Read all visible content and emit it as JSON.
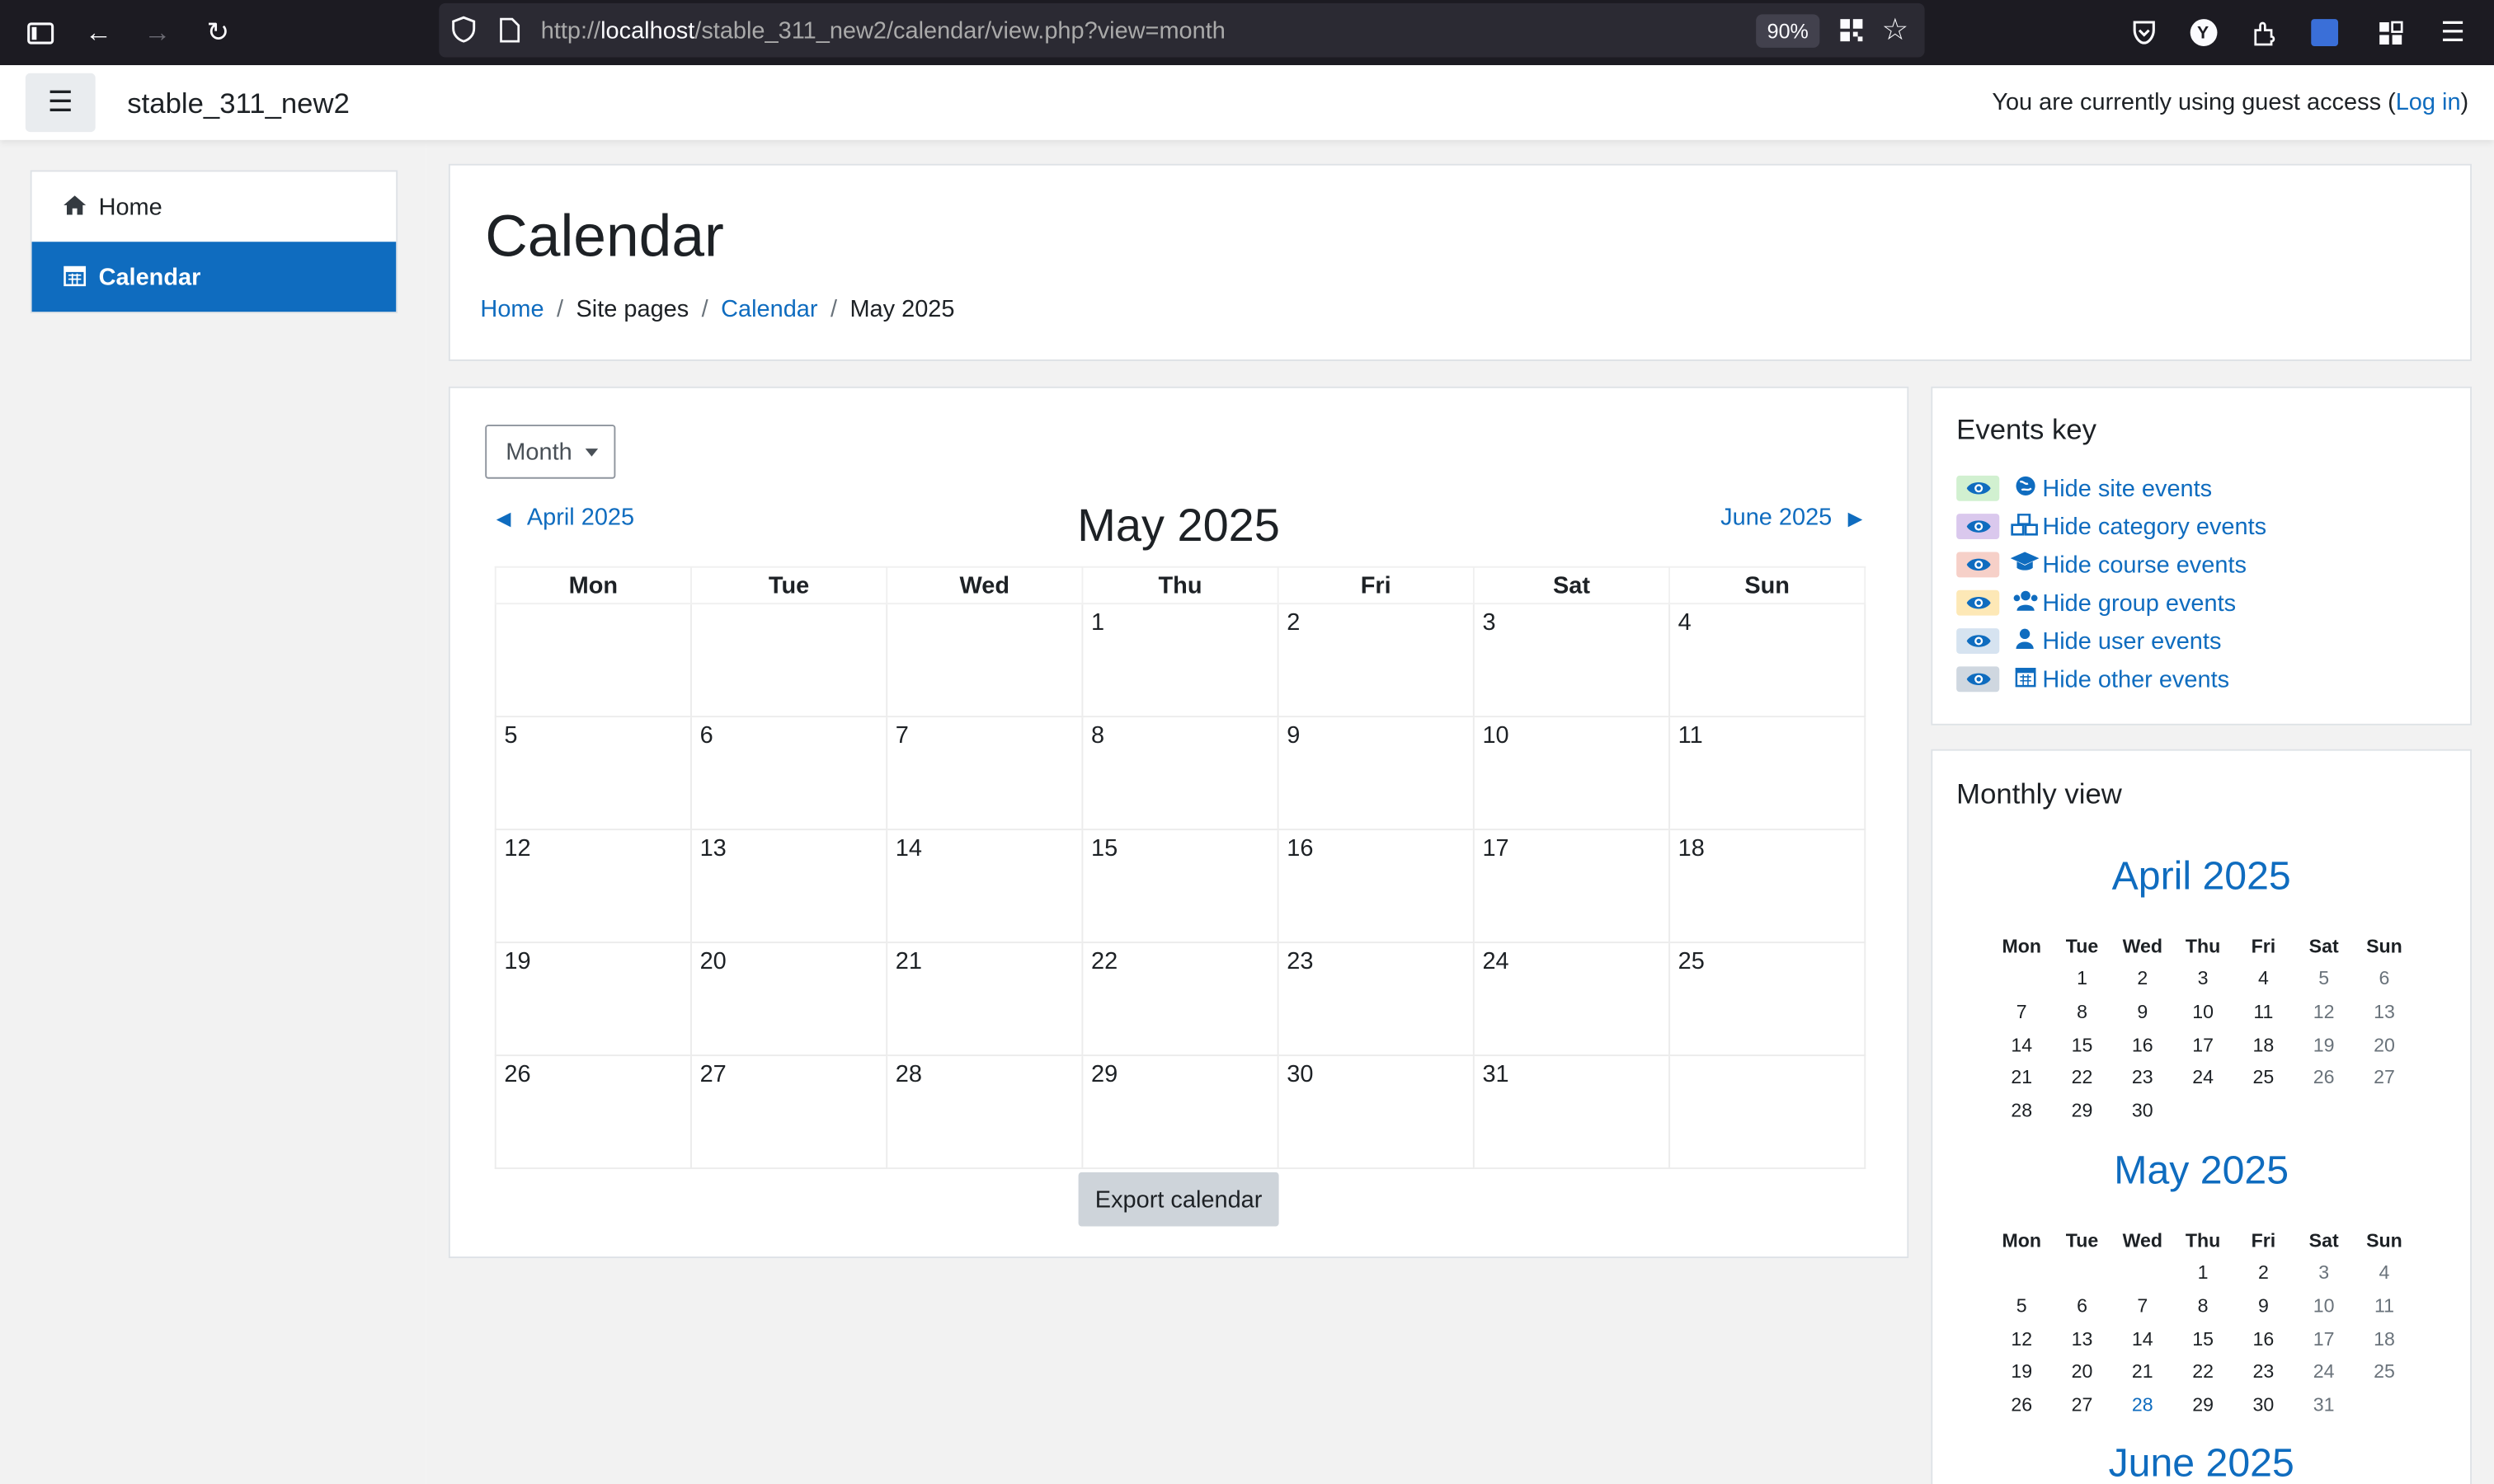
{
  "browser": {
    "url_prefix": "http://",
    "url_host": "localhost",
    "url_path": "/stable_311_new2/calendar/view.php?view=month",
    "zoom": "90%"
  },
  "navbar": {
    "site_name": "stable_311_new2",
    "guest_text": "You are currently using guest access (",
    "login_label": "Log in",
    "guest_close": ")"
  },
  "drawer": {
    "items": [
      {
        "label": "Home",
        "icon": "home-icon",
        "active": false
      },
      {
        "label": "Calendar",
        "icon": "calendar-icon",
        "active": true
      }
    ]
  },
  "header": {
    "title": "Calendar",
    "breadcrumb": [
      "Home",
      "Site pages",
      "Calendar",
      "May 2025"
    ]
  },
  "calendar": {
    "view_select": "Month",
    "prev_label": "April 2025",
    "next_label": "June 2025",
    "month_title": "May 2025",
    "weekdays": [
      "Mon",
      "Tue",
      "Wed",
      "Thu",
      "Fri",
      "Sat",
      "Sun"
    ],
    "weeks": [
      [
        "",
        "",
        "",
        "1",
        "2",
        "3",
        "4"
      ],
      [
        "5",
        "6",
        "7",
        "8",
        "9",
        "10",
        "11"
      ],
      [
        "12",
        "13",
        "14",
        "15",
        "16",
        "17",
        "18"
      ],
      [
        "19",
        "20",
        "21",
        "22",
        "23",
        "24",
        "25"
      ],
      [
        "26",
        "27",
        "28",
        "29",
        "30",
        "31",
        ""
      ]
    ],
    "export_label": "Export calendar"
  },
  "events_key": {
    "title": "Events key",
    "items": [
      {
        "label": "Hide site events",
        "icon": "globe-icon",
        "color": "#d1f0d0"
      },
      {
        "label": "Hide category events",
        "icon": "cubes-icon",
        "color": "#dac8ed"
      },
      {
        "label": "Hide course events",
        "icon": "graduation-cap-icon",
        "color": "#f6d0c8"
      },
      {
        "label": "Hide group events",
        "icon": "users-icon",
        "color": "#fde8b6"
      },
      {
        "label": "Hide user events",
        "icon": "user-icon",
        "color": "#d6e3f0"
      },
      {
        "label": "Hide other events",
        "icon": "calendar-icon",
        "color": "#cfd7e0"
      }
    ]
  },
  "monthly_view": {
    "title": "Monthly view",
    "weekdays": [
      "Mon",
      "Tue",
      "Wed",
      "Thu",
      "Fri",
      "Sat",
      "Sun"
    ],
    "months": [
      {
        "title": "April 2025",
        "weeks": [
          [
            "",
            "1",
            "2",
            "3",
            "4",
            "5",
            "6"
          ],
          [
            "7",
            "8",
            "9",
            "10",
            "11",
            "12",
            "13"
          ],
          [
            "14",
            "15",
            "16",
            "17",
            "18",
            "19",
            "20"
          ],
          [
            "21",
            "22",
            "23",
            "24",
            "25",
            "26",
            "27"
          ],
          [
            "28",
            "29",
            "30",
            "",
            "",
            "",
            ""
          ]
        ]
      },
      {
        "title": "May 2025",
        "today": "28",
        "weeks": [
          [
            "",
            "",
            "",
            "1",
            "2",
            "3",
            "4"
          ],
          [
            "5",
            "6",
            "7",
            "8",
            "9",
            "10",
            "11"
          ],
          [
            "12",
            "13",
            "14",
            "15",
            "16",
            "17",
            "18"
          ],
          [
            "19",
            "20",
            "21",
            "22",
            "23",
            "24",
            "25"
          ],
          [
            "26",
            "27",
            "28",
            "29",
            "30",
            "31",
            ""
          ]
        ]
      },
      {
        "title": "June 2025",
        "weeks": []
      }
    ]
  },
  "colors": {
    "link": "#0f6cbf",
    "active_nav": "#0f6cbf",
    "drawer_bg": "#f2f2f2",
    "browser_bar": "#1c1b22"
  }
}
